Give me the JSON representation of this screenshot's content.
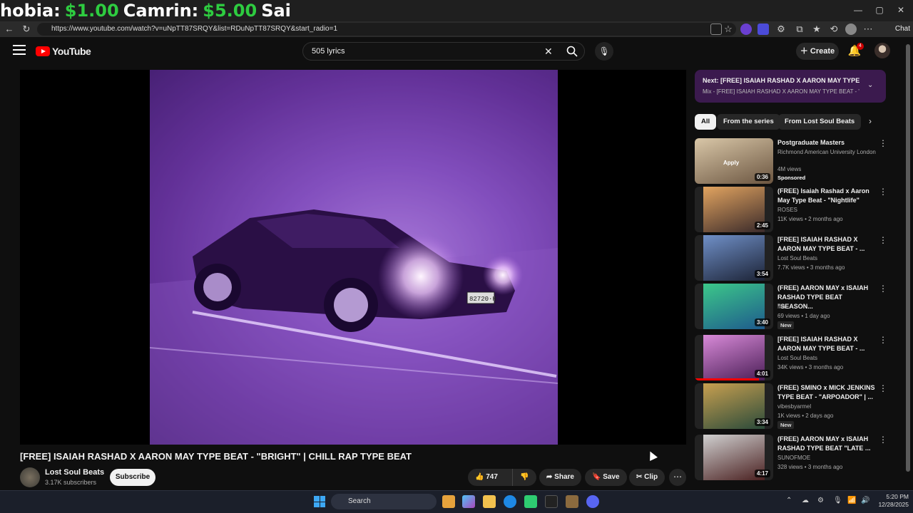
{
  "overlay": {
    "segments": [
      {
        "text": "hobia: ",
        "money": false
      },
      {
        "text": "$1.00",
        "money": true
      },
      {
        "text": "Camrin: ",
        "money": false
      },
      {
        "text": "$5.00",
        "money": true
      },
      {
        "text": "Sai",
        "money": false
      }
    ]
  },
  "browser": {
    "url": "https://www.youtube.com/watch?v=uNpTT87SRQY&list=RDuNpTT87SRQY&start_radio=1",
    "chat_label": "Chat"
  },
  "header": {
    "logo_text": "YouTube",
    "search_value": "505 lyrics",
    "create_label": "Create",
    "notification_count": "4"
  },
  "video": {
    "title": "[FREE] ISAIAH RASHAD X AARON MAY TYPE BEAT - \"BRIGHT\" | CHILL RAP TYPE BEAT",
    "plate_text": "82720·H",
    "channel_name": "Lost Soul Beats",
    "subscribers": "3.17K subscribers",
    "subscribe_label": "Subscribe",
    "likes": "747",
    "share_label": "Share",
    "save_label": "Save",
    "clip_label": "Clip"
  },
  "sidebar": {
    "next_title": "Next: [FREE] ISAIAH RASHAD X AARON MAY TYPE ...",
    "next_sub": "Mix - [FREE] ISAIAH RASHAD X AARON MAY TYPE BEAT - \"B...",
    "chips": [
      "All",
      "From the series",
      "From Lost Soul Beats"
    ],
    "items": [
      {
        "title": "Postgraduate Masters",
        "channel": "Richmond American University London",
        "meta": "4M views",
        "badge": "Sponsored",
        "duration": "0:36",
        "thumb_text": "Apply",
        "color1": "#d9c7a8",
        "color2": "#6b5540"
      },
      {
        "title": "(FREE) Isaiah Rashad x Aaron May Type Beat - \"Nightlife\"",
        "channel": "ROSES",
        "meta": "11K views • 2 months ago",
        "badge": "",
        "duration": "2:45",
        "color1": "#e2a460",
        "color2": "#3a2a2a"
      },
      {
        "title": "[FREE] ISAIAH RASHAD X AARON MAY TYPE BEAT - ...",
        "channel": "Lost Soul Beats",
        "meta": "7.7K views • 3 months ago",
        "badge": "",
        "duration": "3:54",
        "color1": "#7090c8",
        "color2": "#1c2336"
      },
      {
        "title": "(FREE) AARON MAY x ISAIAH RASHAD TYPE BEAT \"SEASON...",
        "channel": "Mal",
        "meta": "69 views • 1 day ago",
        "badge": "New",
        "duration": "3:40",
        "color1": "#3cc88a",
        "color2": "#1e5a8c"
      },
      {
        "title": "[FREE] ISAIAH RASHAD X AARON MAY TYPE BEAT - ...",
        "channel": "Lost Soul Beats",
        "meta": "34K views • 3 months ago",
        "badge": "",
        "duration": "4:01",
        "color1": "#d88ad8",
        "color2": "#4a1e56",
        "progress": 0.82
      },
      {
        "title": "(FREE) SMINO x MICK JENKINS TYPE BEAT - \"ARPOADOR\" | ...",
        "channel": "vibesbyarmel",
        "meta": "1K views • 2 days ago",
        "badge": "New",
        "duration": "3:34",
        "color1": "#c8a050",
        "color2": "#2a4a3a"
      },
      {
        "title": "(FREE) AARON MAY x ISAIAH RASHAD TYPE BEAT \"LATE ...",
        "channel": "SUNOFMOE",
        "meta": "328 views • 3 months ago",
        "badge": "",
        "duration": "4:17",
        "color1": "#d0d0d0",
        "color2": "#4a2020"
      }
    ]
  },
  "taskbar": {
    "search_label": "Search",
    "time": "5:20 PM",
    "date": "12/28/2025"
  }
}
